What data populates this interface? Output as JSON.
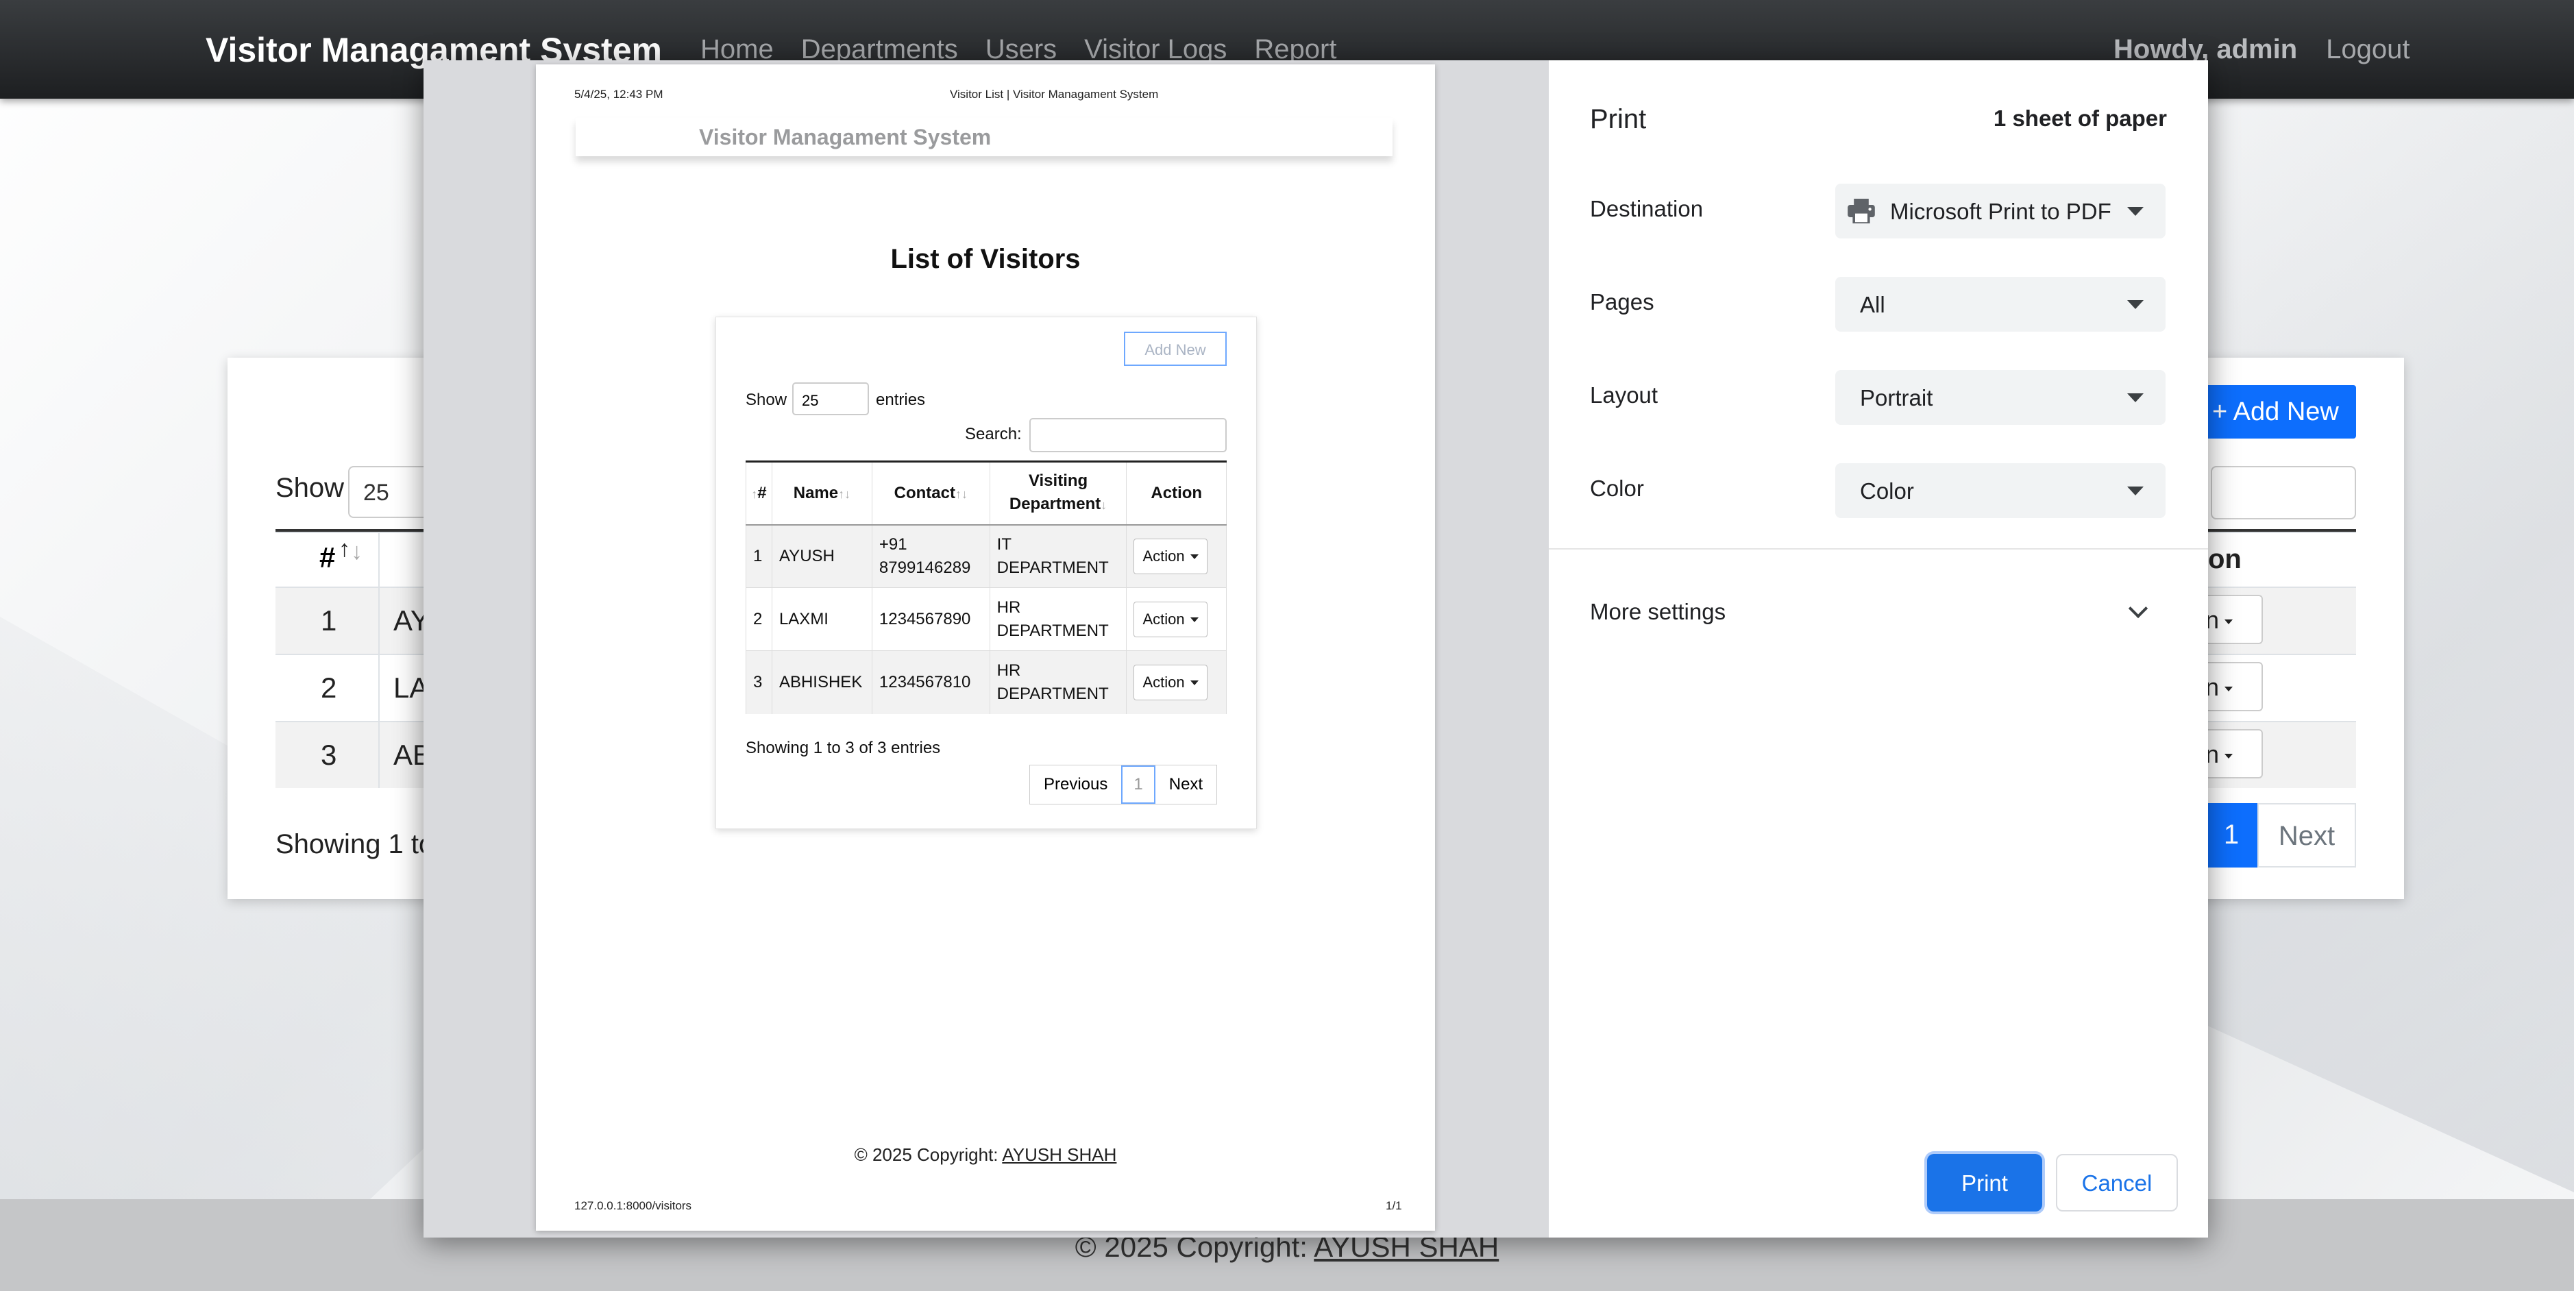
{
  "background": {
    "brand": "Visitor Managament System",
    "nav": [
      "Home",
      "Departments",
      "Users",
      "Visitor Logs",
      "Report"
    ],
    "howdy": "Howdy, admin",
    "logout": "Logout",
    "show_label": "Show",
    "show_value": "25",
    "hash": "#",
    "rows": [
      {
        "num": "1",
        "name": "AY"
      },
      {
        "num": "2",
        "name": "LA"
      },
      {
        "num": "3",
        "name": "AB"
      }
    ],
    "showing": "Showing 1 to",
    "add_new": "+ Add New",
    "action_head": "on",
    "action_btn": "n",
    "page_current": "1",
    "page_next": "Next",
    "footer_text": "© 2025 Copyright: ",
    "footer_link": "AYUSH SHAH"
  },
  "preview": {
    "datetime": "5/4/25, 12:43 PM",
    "page_title": "Visitor List | Visitor Managament System",
    "brand": "Visitor Managament System",
    "heading": "List of Visitors",
    "add_new": "Add New",
    "show_label": "Show",
    "show_value": "25",
    "entries_label": "entries",
    "search_label": "Search:",
    "columns": [
      "#",
      "Name",
      "Contact",
      "Visiting Department",
      "Action"
    ],
    "rows": [
      {
        "num": "1",
        "name": "AYUSH",
        "contact": "+91 8799146289",
        "dept": "IT DEPARTMENT",
        "action": "Action"
      },
      {
        "num": "2",
        "name": "LAXMI",
        "contact": "1234567890",
        "dept": "HR DEPARTMENT",
        "action": "Action"
      },
      {
        "num": "3",
        "name": "ABHISHEK",
        "contact": "1234567810",
        "dept": "HR DEPARTMENT",
        "action": "Action"
      }
    ],
    "showing": "Showing 1 to 3 of 3 entries",
    "pager": {
      "previous": "Previous",
      "current": "1",
      "next": "Next"
    },
    "footer_text": "© 2025 Copyright: ",
    "footer_link": "AYUSH SHAH",
    "url": "127.0.0.1:8000/visitors",
    "page_count": "1/1"
  },
  "print": {
    "title": "Print",
    "sheets": "1 sheet of paper",
    "destination_label": "Destination",
    "destination_value": "Microsoft Print to PDF",
    "pages_label": "Pages",
    "pages_value": "All",
    "layout_label": "Layout",
    "layout_value": "Portrait",
    "color_label": "Color",
    "color_value": "Color",
    "more_settings": "More settings",
    "print_btn": "Print",
    "cancel_btn": "Cancel"
  }
}
